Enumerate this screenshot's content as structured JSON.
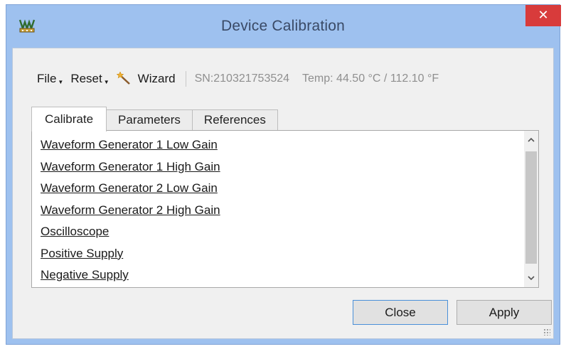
{
  "window": {
    "title": "Device Calibration",
    "close_symbol": "✕"
  },
  "toolbar": {
    "file_label": "File",
    "reset_label": "Reset",
    "wizard_label": "Wizard",
    "serial": "SN:210321753524",
    "temperature": "Temp: 44.50 °C / 112.10 °F"
  },
  "tabs": [
    {
      "label": "Calibrate",
      "active": true
    },
    {
      "label": "Parameters",
      "active": false
    },
    {
      "label": "References",
      "active": false
    }
  ],
  "calibrate_items": [
    "Waveform Generator 1 Low Gain",
    "Waveform Generator 1 High Gain",
    "Waveform Generator 2 Low Gain",
    "Waveform Generator 2 High Gain",
    "Oscilloscope",
    "Positive Supply",
    "Negative Supply"
  ],
  "buttons": {
    "close_label": "Close",
    "apply_label": "Apply"
  },
  "icons": {
    "app": "device-calibration-icon",
    "wizard": "magic-wand-icon",
    "scroll_up": "chevron-up-icon",
    "scroll_down": "chevron-down-icon"
  },
  "colors": {
    "window_frame": "#9ec1ef",
    "close_button": "#d83b3b",
    "client_bg": "#f0f0f0",
    "default_button_border": "#4a90d9"
  }
}
